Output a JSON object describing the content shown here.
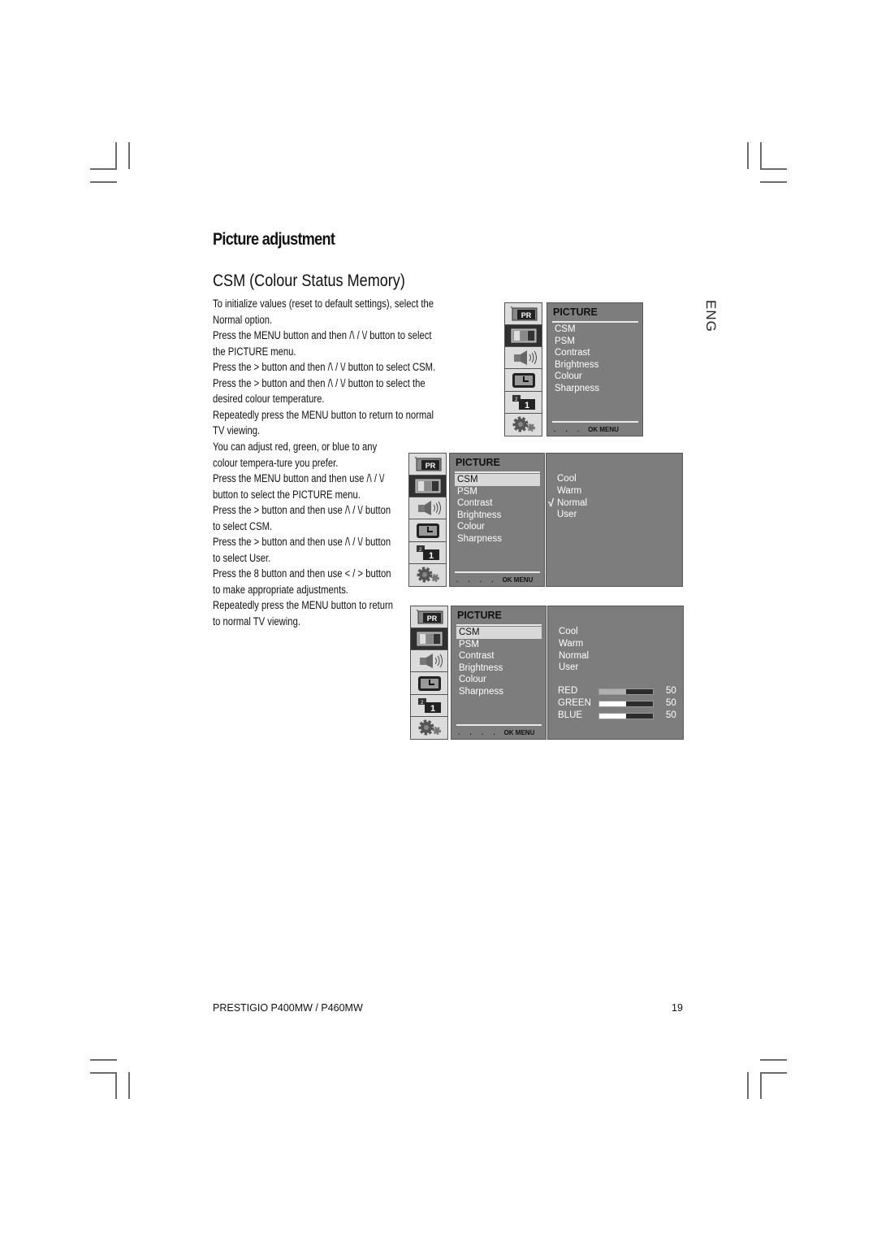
{
  "page": {
    "title": "Picture adjustment",
    "subtitle": "CSM (Colour Status Memory)",
    "language_tab": "ENG",
    "paragraph1": [
      "To initialize values (reset to default settings), select the Normal option.",
      "Press the MENU button and then /\\ / \\/ button to select the PICTURE menu.",
      "Press the > button and then /\\ / \\/ button to select CSM.",
      "Press the > button and then /\\ / \\/ button to select the desired colour temperature.",
      "Repeatedly press the MENU button to return to normal TV viewing."
    ],
    "paragraph2": [
      "You can adjust red, green, or blue to any colour tempera-ture you prefer.",
      "Press the MENU button and then use /\\ / \\/ button to select the PICTURE menu.",
      "Press the > button and then use /\\ / \\/ button to select CSM.",
      "Press the > button and then use /\\ / \\/ button to select User.",
      "Press the 8 button and then use < / > button to make appropriate adjustments.",
      "Repeatedly press the MENU button to return to normal TV viewing."
    ],
    "footer": {
      "model": "PRESTIGIO P400MW / P460MW",
      "page_number": "19"
    }
  },
  "osd": {
    "sidebar_icons": [
      "pr-channel-icon",
      "picture-icon",
      "speaker-icon",
      "clock-icon",
      "pip-icon",
      "gear-icon"
    ],
    "sidebar_pr_label": "PR",
    "sidebar_pip_label": "1",
    "panel_title": "PICTURE",
    "menu_items": [
      "CSM",
      "PSM",
      "Contrast",
      "Brightness",
      "Colour",
      "Sharpness"
    ],
    "footer_dots": ". . .",
    "footer_dots_4": ". . . .",
    "footer_label": "OK MENU",
    "csm_options": [
      "Cool",
      "Warm",
      "Normal",
      "User"
    ],
    "checked_option": "Normal",
    "check_mark": "√",
    "selected_item": "CSM",
    "rgb": [
      {
        "label": "RED",
        "value": "50",
        "percent": 50
      },
      {
        "label": "GREEN",
        "value": "50",
        "percent": 50
      },
      {
        "label": "BLUE",
        "value": "50",
        "percent": 50
      }
    ]
  }
}
